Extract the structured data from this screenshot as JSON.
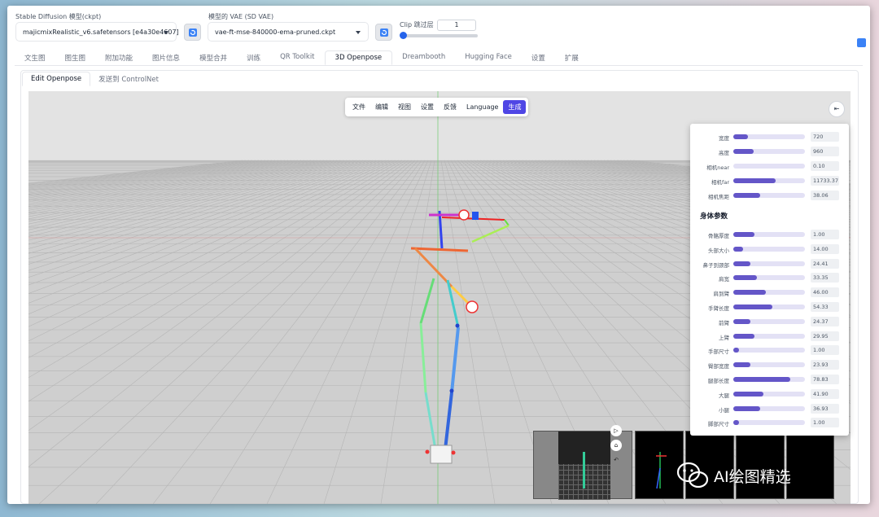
{
  "header": {
    "sd_model_label": "Stable Diffusion 模型(ckpt)",
    "sd_model_value": "majicmixRealistic_v6.safetensors [e4a30e4607]",
    "vae_label": "模型的 VAE (SD VAE)",
    "vae_value": "vae-ft-mse-840000-ema-pruned.ckpt",
    "clip_label": "Clip 跳过层",
    "clip_value": "1",
    "clip_slider_level": 0
  },
  "tabs": [
    {
      "label": "文生图"
    },
    {
      "label": "图生图"
    },
    {
      "label": "附加功能"
    },
    {
      "label": "图片信息"
    },
    {
      "label": "模型合并"
    },
    {
      "label": "训练"
    },
    {
      "label": "QR Toolkit"
    },
    {
      "label": "3D Openpose"
    },
    {
      "label": "Dreambooth"
    },
    {
      "label": "Hugging Face"
    },
    {
      "label": "设置"
    },
    {
      "label": "扩展"
    }
  ],
  "active_tab": "3D Openpose",
  "subtabs": [
    {
      "label": "Edit Openpose"
    },
    {
      "label": "发送到 ControlNet"
    }
  ],
  "menu": [
    {
      "label": "文件"
    },
    {
      "label": "编辑"
    },
    {
      "label": "视图"
    },
    {
      "label": "设置"
    },
    {
      "label": "反馈"
    },
    {
      "label": "Language"
    },
    {
      "label": "生成"
    }
  ],
  "panel": {
    "camera_params": [
      {
        "label": "宽度",
        "value": "720",
        "fill": 0.2
      },
      {
        "label": "高度",
        "value": "960",
        "fill": 0.28
      },
      {
        "label": "相机near",
        "value": "0.10",
        "fill": 0.0
      },
      {
        "label": "相机far",
        "value": "11733.37",
        "fill": 0.59
      },
      {
        "label": "相机焦距",
        "value": "38.06",
        "fill": 0.38
      }
    ],
    "body_title": "身体参数",
    "body_params": [
      {
        "label": "骨骼厚度",
        "value": "1.00",
        "fill": 0.3
      },
      {
        "label": "头部大小",
        "value": "14.00",
        "fill": 0.14
      },
      {
        "label": "鼻子到颈部",
        "value": "24.41",
        "fill": 0.24
      },
      {
        "label": "肩宽",
        "value": "33.35",
        "fill": 0.33
      },
      {
        "label": "肩到臂",
        "value": "46.00",
        "fill": 0.46
      },
      {
        "label": "手臂长度",
        "value": "54.33",
        "fill": 0.54
      },
      {
        "label": "前臂",
        "value": "24.37",
        "fill": 0.24
      },
      {
        "label": "上臂",
        "value": "29.95",
        "fill": 0.3
      },
      {
        "label": "手部尺寸",
        "value": "1.00",
        "fill": 0.08
      },
      {
        "label": "臀部宽度",
        "value": "23.93",
        "fill": 0.24
      },
      {
        "label": "腿部长度",
        "value": "78.83",
        "fill": 0.79
      },
      {
        "label": "大腿",
        "value": "41.90",
        "fill": 0.42
      },
      {
        "label": "小腿",
        "value": "36.93",
        "fill": 0.37
      },
      {
        "label": "脚部尺寸",
        "value": "1.00",
        "fill": 0.08
      }
    ]
  },
  "watermark": "AI绘图精选",
  "colors": {
    "accent": "#4f46e5",
    "slider_fill": "#6456c8",
    "slider_track": "#e3e1f5"
  },
  "icons": [
    "refresh-icon",
    "caret-down-icon",
    "collapse-panel-icon",
    "play-icon",
    "lock-icon",
    "undo-icon",
    "wechat-icon"
  ]
}
